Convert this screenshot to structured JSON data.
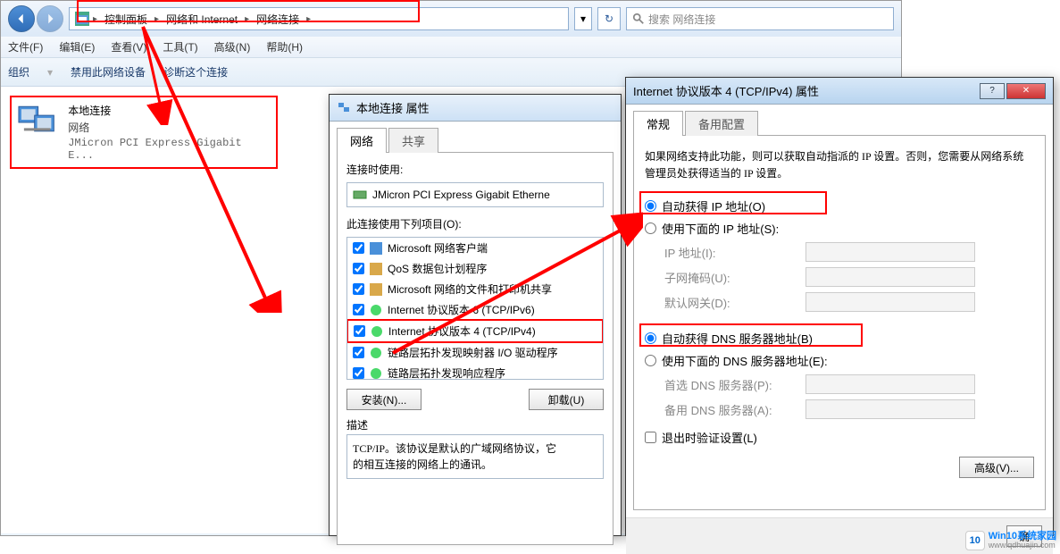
{
  "breadcrumb": {
    "items": [
      "控制面板",
      "网络和 Internet",
      "网络连接"
    ]
  },
  "search": {
    "placeholder": "搜索 网络连接"
  },
  "menubar": [
    "文件(F)",
    "编辑(E)",
    "查看(V)",
    "工具(T)",
    "高级(N)",
    "帮助(H)"
  ],
  "cmdbar": {
    "org": "组织",
    "disable": "禁用此网络设备",
    "diag": "诊断这个连接"
  },
  "nic": {
    "name": "本地连接",
    "status": "网络",
    "adapter": "JMicron PCI Express Gigabit E..."
  },
  "dlg1": {
    "title": "本地连接 属性",
    "tabs": [
      "网络",
      "共享"
    ],
    "conn_label": "连接时使用:",
    "conn_adapter": "JMicron PCI Express Gigabit Etherne",
    "items_label": "此连接使用下列项目(O):",
    "items": [
      {
        "label": "Microsoft 网络客户端",
        "checked": true,
        "type": "client"
      },
      {
        "label": "QoS 数据包计划程序",
        "checked": true,
        "type": "service"
      },
      {
        "label": "Microsoft 网络的文件和打印机共享",
        "checked": true,
        "type": "service"
      },
      {
        "label": "Internet 协议版本 6 (TCP/IPv6)",
        "checked": true,
        "type": "protocol"
      },
      {
        "label": "Internet 协议版本 4 (TCP/IPv4)",
        "checked": true,
        "type": "protocol",
        "highlight": true
      },
      {
        "label": "链路层拓扑发现映射器 I/O 驱动程序",
        "checked": true,
        "type": "protocol"
      },
      {
        "label": "链路层拓扑发现响应程序",
        "checked": true,
        "type": "protocol"
      }
    ],
    "btn_install": "安装(N)...",
    "btn_uninstall": "卸载(U)",
    "desc_label": "描述",
    "desc_text": "TCP/IP。该协议是默认的广域网络协议，它\n的相互连接的网络上的通讯。"
  },
  "dlg2": {
    "title": "Internet 协议版本 4 (TCP/IPv4) 属性",
    "tabs": [
      "常规",
      "备用配置"
    ],
    "help": "如果网络支持此功能，则可以获取自动指派的 IP 设置。否则，您需要从网络系统管理员处获得适当的 IP 设置。",
    "r_auto_ip": "自动获得 IP 地址(O)",
    "r_manual_ip": "使用下面的 IP 地址(S):",
    "f_ip": "IP 地址(I):",
    "f_mask": "子网掩码(U):",
    "f_gw": "默认网关(D):",
    "r_auto_dns": "自动获得 DNS 服务器地址(B)",
    "r_manual_dns": "使用下面的 DNS 服务器地址(E):",
    "f_dns1": "首选 DNS 服务器(P):",
    "f_dns2": "备用 DNS 服务器(A):",
    "chk_validate": "退出时验证设置(L)",
    "btn_adv": "高级(V)...",
    "btn_ok": "确"
  },
  "watermark": {
    "t1": "Win10系统家园",
    "t2": "www.qdhuajin.com"
  }
}
